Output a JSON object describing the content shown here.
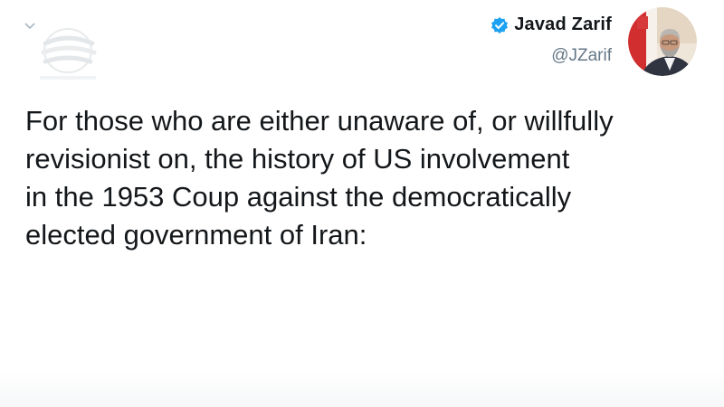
{
  "tweet": {
    "author": {
      "display_name": "Javad Zarif",
      "handle": "@JZarif",
      "verified": true,
      "verified_icon": "verified-badge-icon",
      "avatar_icon": "profile-avatar"
    },
    "menu_icon": "chevron-down-icon",
    "text": "For those who are either unaware of, or willfully\nrevisionist on, the history of US involvement\nin the 1953 Coup against the democratically\nelected government of Iran:"
  },
  "colors": {
    "text": "#14171a",
    "handle": "#657786",
    "verified": "#1da1f2",
    "background": "#ffffff"
  }
}
